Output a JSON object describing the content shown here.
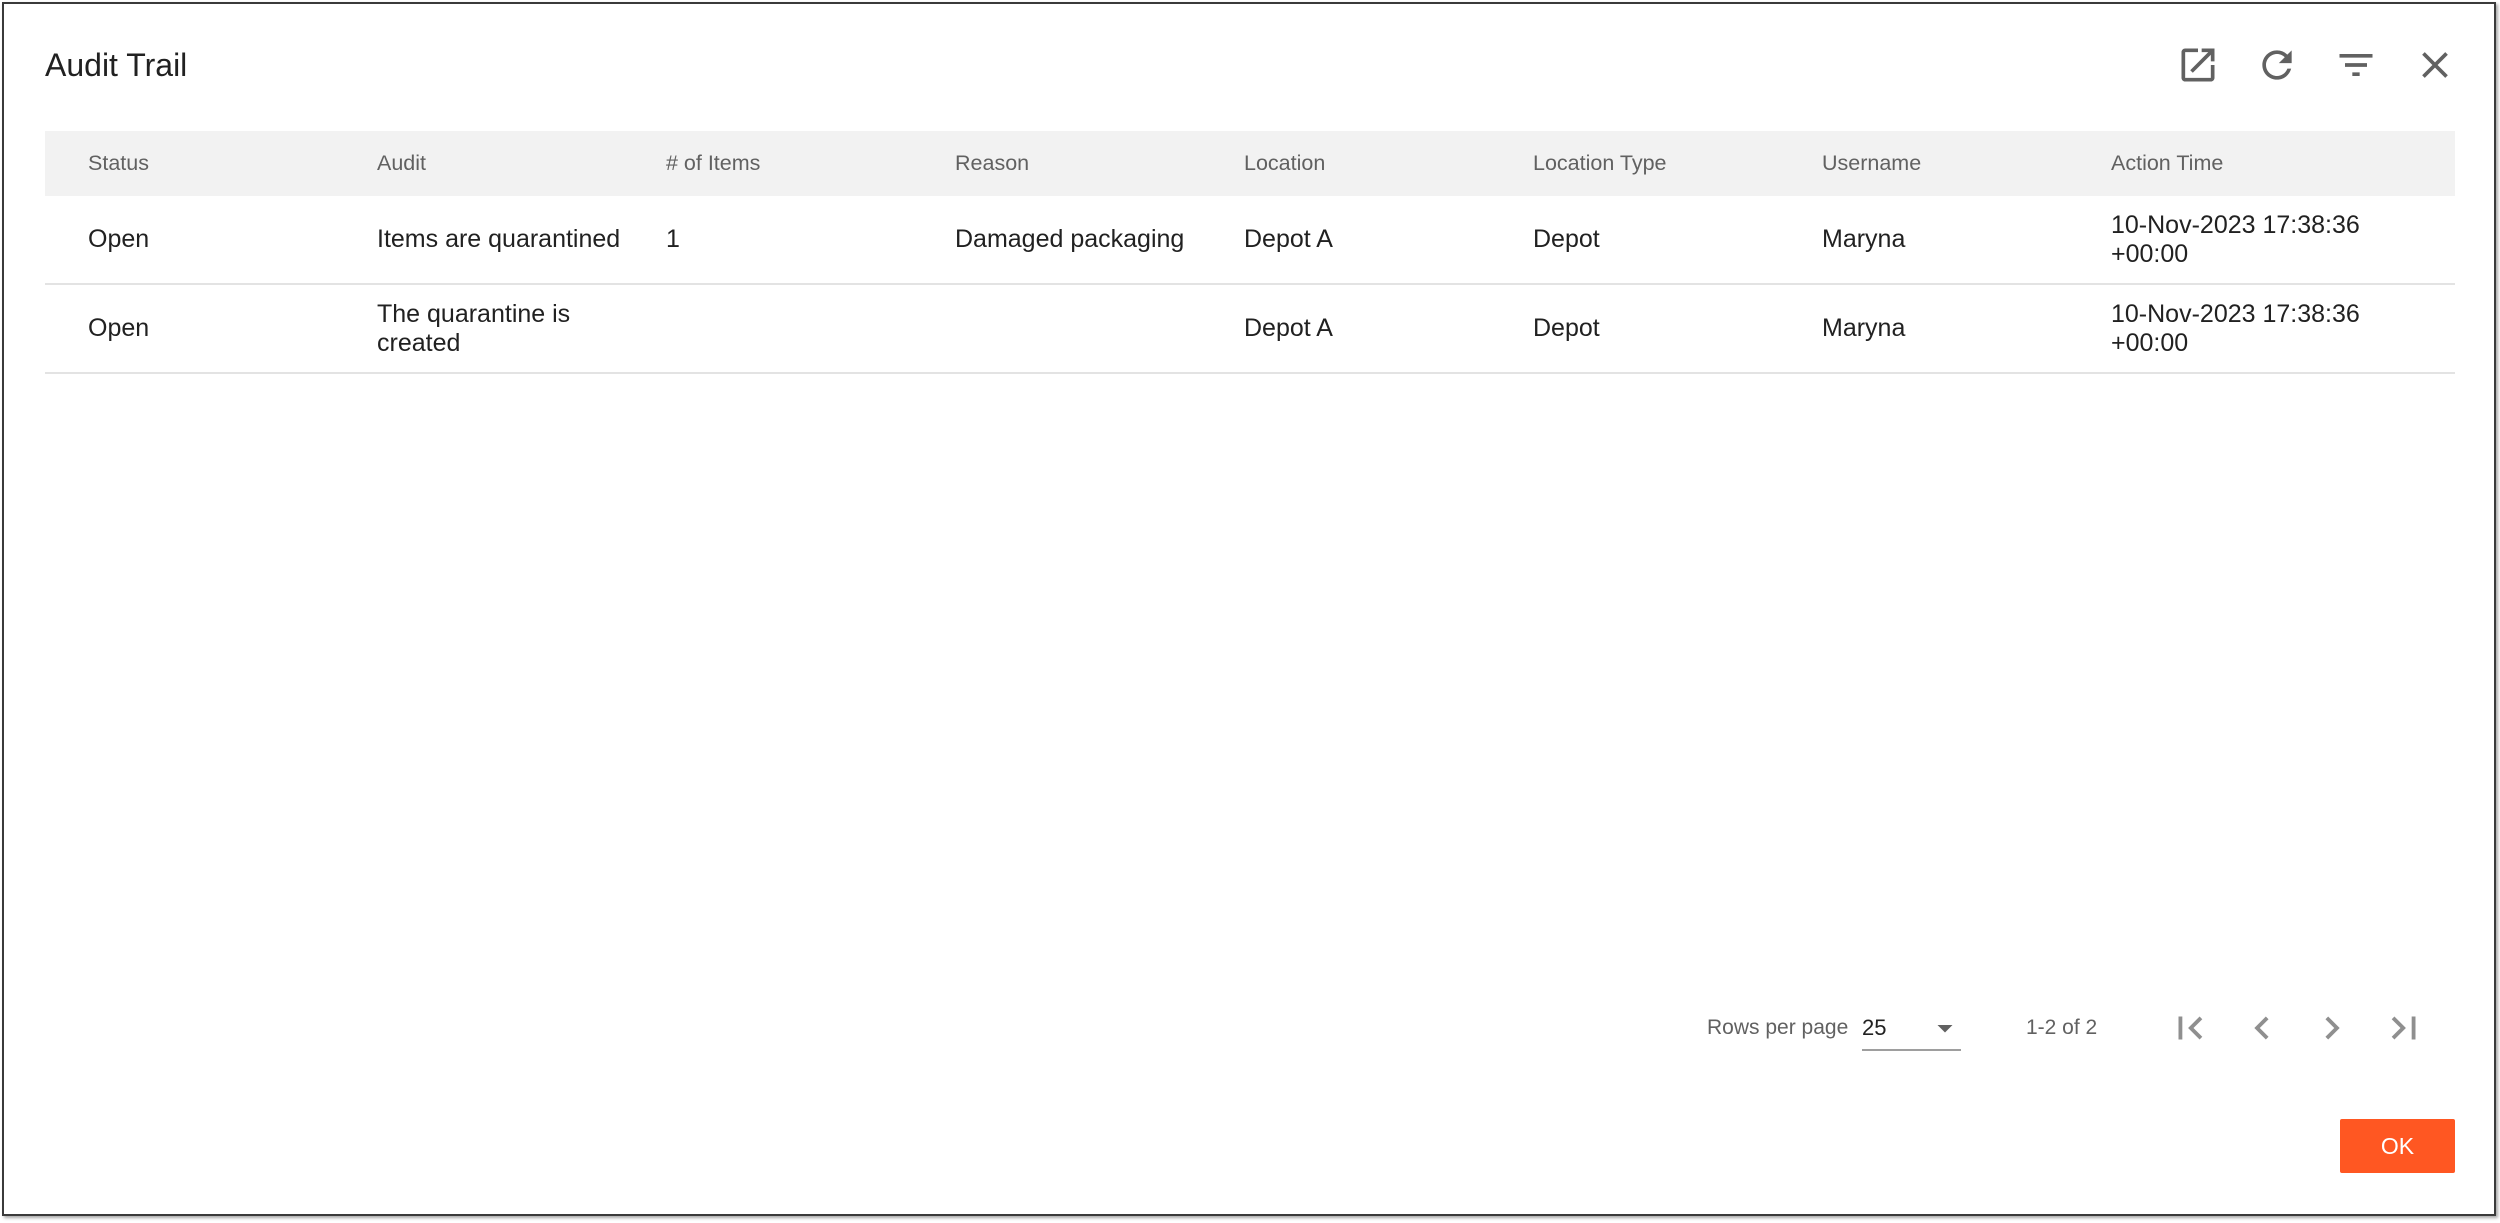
{
  "dialog": {
    "title": "Audit Trail",
    "toolbar_icons": [
      "open-in-new-icon",
      "refresh-icon",
      "filter-icon",
      "close-icon"
    ]
  },
  "table": {
    "columns": [
      "Status",
      "Audit",
      "# of Items",
      "Reason",
      "Location",
      "Location Type",
      "Username",
      "Action Time"
    ],
    "rows": [
      {
        "status": "Open",
        "audit": "Items are quarantined",
        "items_count": "1",
        "reason": "Damaged packaging",
        "location": "Depot A",
        "location_type": "Depot",
        "username": "Maryna",
        "action_time": "10-Nov-2023 17:38:36 +00:00"
      },
      {
        "status": "Open",
        "audit": "The quarantine is created",
        "location": "Depot A",
        "location_type": "Depot",
        "username": "Maryna",
        "action_time": "10-Nov-2023 17:38:36 +00:00"
      }
    ]
  },
  "pagination": {
    "rows_per_page_label": "Rows per page",
    "rows_per_page_value": "25",
    "rows_per_page_icon": "arrow-drop-down-icon",
    "range_label": "1-2 of 2",
    "nav_icons": [
      "first-page-icon",
      "previous-page-icon",
      "next-page-icon",
      "last-page-icon"
    ]
  },
  "footer": {
    "ok_label": "OK"
  },
  "colors": {
    "accent": "#ff5722",
    "table_header_bg": "#f2f2f2"
  }
}
